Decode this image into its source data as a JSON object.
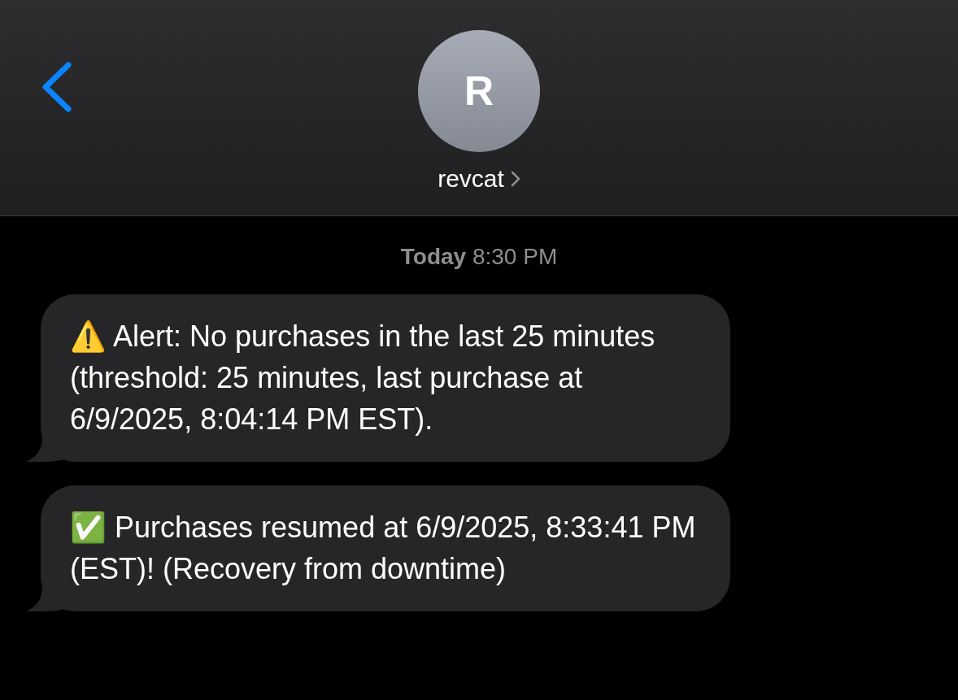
{
  "header": {
    "avatar_initial": "R",
    "contact_name": "revcat"
  },
  "timestamp": {
    "day": "Today",
    "time": "8:30 PM"
  },
  "messages": [
    {
      "text": "⚠️ Alert: No purchases in the last 25 minutes (threshold: 25 minutes, last purchase at 6/9/2025, 8:04:14 PM EST)."
    },
    {
      "text": "✅ Purchases resumed at 6/9/2025, 8:33:41 PM (EST)! (Recovery from downtime)"
    }
  ]
}
